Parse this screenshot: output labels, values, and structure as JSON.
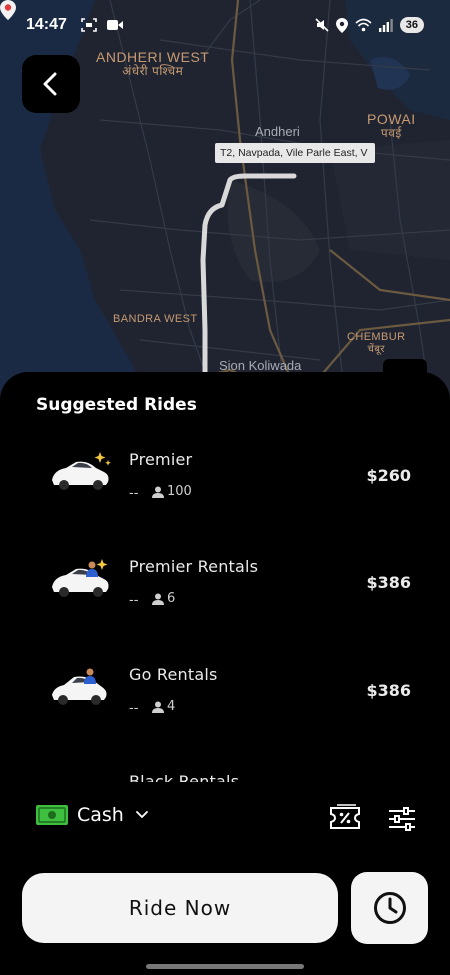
{
  "status_bar": {
    "time": "14:47",
    "battery": "36"
  },
  "map": {
    "labels": {
      "andheri_west": "ANDHERI WEST",
      "andheri_west_hindi": "अंधेरी पश्चिम",
      "powai": "POWAI",
      "powai_hindi": "पवई",
      "andheri": "Andheri",
      "bandra_west": "BANDRA WEST",
      "chembur": "CHEMBUR",
      "chembur_hindi": "चेंबूर",
      "sion_koliwada": "Sion Koliwada"
    },
    "destination_tag": "T2, Navpada, Vile Parle East, V"
  },
  "sheet": {
    "title": "Suggested Rides"
  },
  "rides": [
    {
      "name": "Premier",
      "eta": "--",
      "capacity": "100",
      "price": "$260",
      "car_icon": "sedan-sparkle-icon"
    },
    {
      "name": "Premier Rentals",
      "eta": "--",
      "capacity": "6",
      "price": "$386",
      "car_icon": "sedan-driver-sparkle-icon"
    },
    {
      "name": "Go Rentals",
      "eta": "--",
      "capacity": "4",
      "price": "$386",
      "car_icon": "hatchback-driver-icon"
    },
    {
      "name": "Black Rentals",
      "eta": "",
      "capacity": "",
      "price": "",
      "car_icon": "car-icon"
    }
  ],
  "payment": {
    "method": "Cash"
  },
  "actions": {
    "ride_now_label": "Ride Now"
  },
  "colors": {
    "accent_green": "#3fbf3f",
    "button_bg": "#f4f4f4",
    "map_label": "#c79a72"
  }
}
